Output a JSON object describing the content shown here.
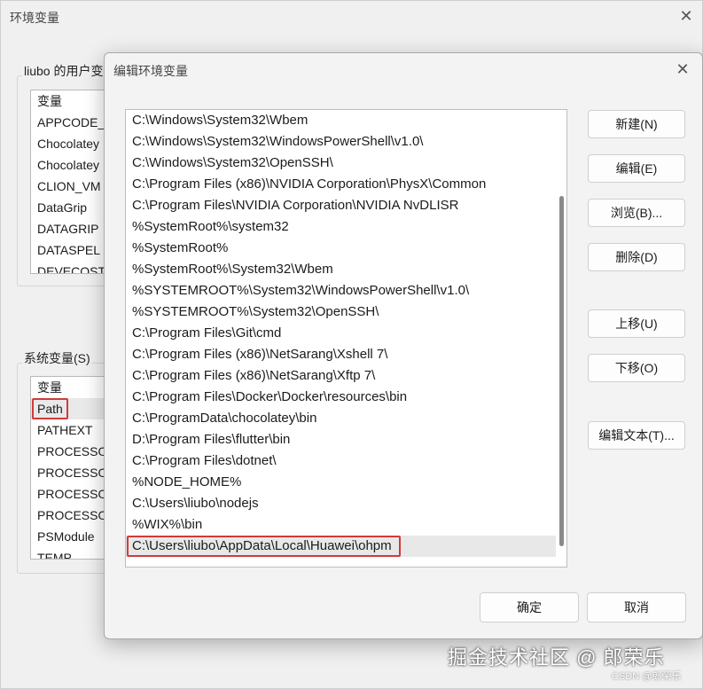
{
  "background_window": {
    "title": "环境变量",
    "user_group_label": "liubo 的用户变",
    "user_vars_header": "变量",
    "user_vars": [
      "APPCODE_",
      "Chocolatey",
      "Chocolatey",
      "CLION_VM",
      "DataGrip",
      "DATAGRIP",
      "DATASPEL",
      "DEVECOST"
    ],
    "system_group_label": "系统变量(S)",
    "system_vars_header": "变量",
    "system_vars": [
      "Path",
      "PATHEXT",
      "PROCESSO",
      "PROCESSO",
      "PROCESSO",
      "PROCESSO",
      "PSModule",
      "TEMP"
    ]
  },
  "dialog": {
    "title": "编辑环境变量",
    "paths": [
      "C:\\Windows\\System32\\Wbem",
      "C:\\Windows\\System32\\WindowsPowerShell\\v1.0\\",
      "C:\\Windows\\System32\\OpenSSH\\",
      "C:\\Program Files (x86)\\NVIDIA Corporation\\PhysX\\Common",
      "C:\\Program Files\\NVIDIA Corporation\\NVIDIA NvDLISR",
      "%SystemRoot%\\system32",
      "%SystemRoot%",
      "%SystemRoot%\\System32\\Wbem",
      "%SYSTEMROOT%\\System32\\WindowsPowerShell\\v1.0\\",
      "%SYSTEMROOT%\\System32\\OpenSSH\\",
      "C:\\Program Files\\Git\\cmd",
      "C:\\Program Files (x86)\\NetSarang\\Xshell 7\\",
      "C:\\Program Files (x86)\\NetSarang\\Xftp 7\\",
      "C:\\Program Files\\Docker\\Docker\\resources\\bin",
      "C:\\ProgramData\\chocolatey\\bin",
      "D:\\Program Files\\flutter\\bin",
      "C:\\Program Files\\dotnet\\",
      "%NODE_HOME%",
      "C:\\Users\\liubo\\nodejs",
      "%WIX%\\bin",
      "C:\\Users\\liubo\\AppData\\Local\\Huawei\\ohpm"
    ],
    "buttons": {
      "new": "新建(N)",
      "edit": "编辑(E)",
      "browse": "浏览(B)...",
      "delete": "删除(D)",
      "move_up": "上移(U)",
      "move_down": "下移(O)",
      "edit_text": "编辑文本(T)...",
      "ok": "确定",
      "cancel": "取消"
    }
  },
  "watermark": {
    "text": "掘金技术社区 @ 郎荣乐",
    "csdn": "CSDN @郎荣乐"
  }
}
